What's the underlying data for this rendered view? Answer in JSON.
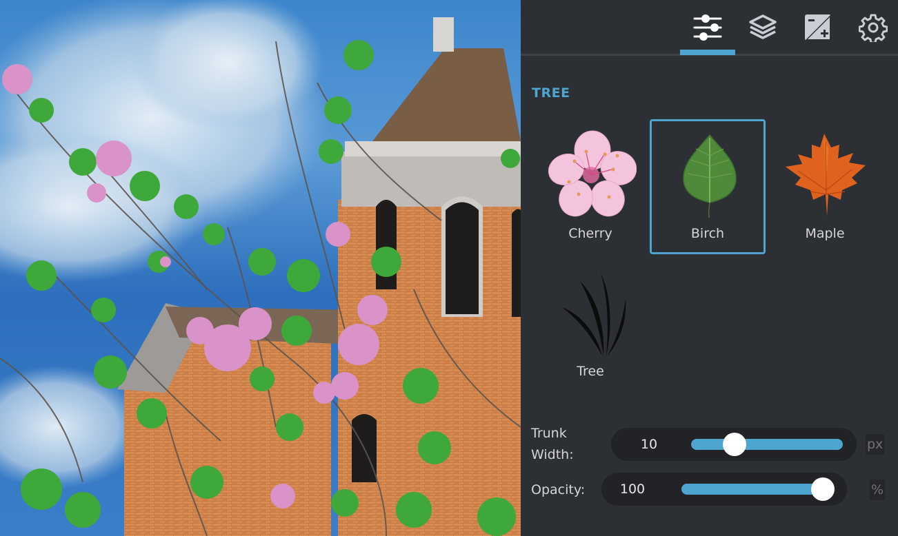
{
  "canvas": {
    "description": "Photo of a brick Victorian building with a tower under a blue cloudy sky, overlaid with painted tree branches bearing green leaves and pink blossoms"
  },
  "tabs": [
    {
      "name": "adjust",
      "icon": "sliders-icon",
      "active": true
    },
    {
      "name": "layers",
      "icon": "layers-icon",
      "active": false
    },
    {
      "name": "exposure",
      "icon": "exposure-icon",
      "active": false
    },
    {
      "name": "settings",
      "icon": "gear-icon",
      "active": false
    }
  ],
  "section": {
    "title": "TREE"
  },
  "brushes": [
    {
      "label": "Cherry",
      "icon": "cherry-blossom-icon",
      "selected": false
    },
    {
      "label": "Birch",
      "icon": "birch-leaf-icon",
      "selected": true
    },
    {
      "label": "Maple",
      "icon": "maple-leaf-icon",
      "selected": false
    },
    {
      "label": "Tree",
      "icon": "grass-blades-icon",
      "selected": false
    }
  ],
  "sliders": {
    "trunk_width": {
      "label_line1": "Trunk",
      "label_line2": "Width:",
      "value": "10",
      "unit": "px",
      "fraction": 0.25
    },
    "opacity": {
      "label": "Opacity:",
      "value": "100",
      "unit": "%",
      "fraction": 1.0
    }
  },
  "colors": {
    "accent": "#4ea5cf",
    "panel_bg": "#2c2f33",
    "slider_bg": "#212326",
    "text": "#d4d6d9"
  }
}
